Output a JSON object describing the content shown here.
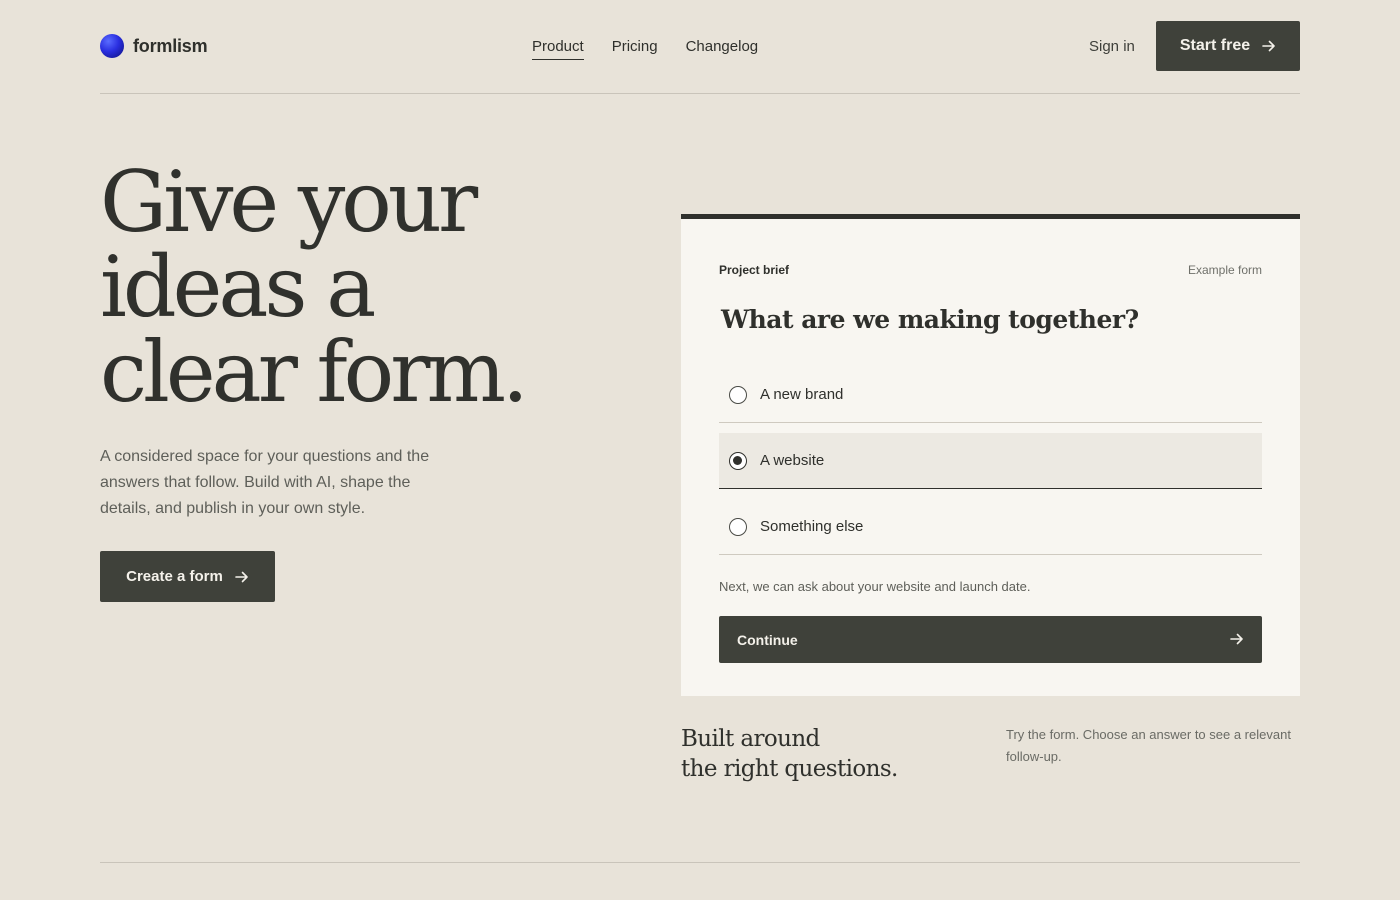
{
  "brand": {
    "name": "formlism"
  },
  "nav": {
    "items": [
      {
        "label": "Product",
        "active": true
      },
      {
        "label": "Pricing",
        "active": false
      },
      {
        "label": "Changelog",
        "active": false
      }
    ],
    "signin": "Sign in",
    "cta": "Start free"
  },
  "hero": {
    "title_lines": [
      "Give your",
      "ideas a",
      "clear form."
    ],
    "subtitle": "A considered space for your questions and the answers that follow. Build with AI, shape the details, and publish in your own style.",
    "cta": "Create a form"
  },
  "form_card": {
    "label": "Project brief",
    "tag": "Example form",
    "question": "What are we making together?",
    "options": [
      {
        "label": "A new brand",
        "selected": false
      },
      {
        "label": "A website",
        "selected": true
      },
      {
        "label": "Something else",
        "selected": false
      }
    ],
    "hint": "Next, we can ask about your website and launch date.",
    "continue": "Continue"
  },
  "footer_note": {
    "heading_lines": [
      "Built around",
      "the right questions."
    ],
    "text": "Try the form. Choose an answer to see a relevant follow-up."
  },
  "colors": {
    "background": "#e8e3d9",
    "card": "#f8f6f1",
    "button": "#3f413a",
    "text": "#2f302c",
    "logo": "#2a2fe0"
  },
  "icons": [
    "logo-dot-icon",
    "arrow-right-icon",
    "radio-icon"
  ]
}
